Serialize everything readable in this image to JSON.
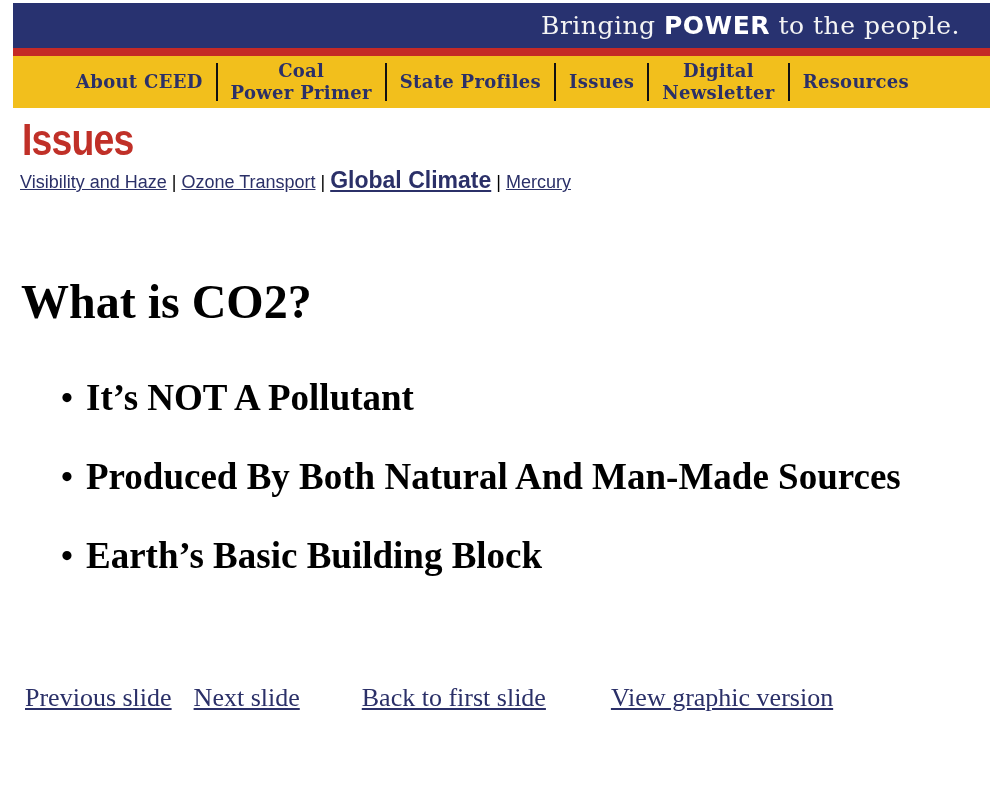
{
  "banner": {
    "tagline": "Bringing **POWER** to the people."
  },
  "nav": [
    {
      "label": "About CEED"
    },
    {
      "label": "Coal\nPower Primer"
    },
    {
      "label": "State Profiles"
    },
    {
      "label": "Issues"
    },
    {
      "label": "Digital\nNewsletter"
    },
    {
      "label": "Resources"
    }
  ],
  "section_title": "Issues",
  "subnav": {
    "separator": "|",
    "items": [
      {
        "label": "Visibility and Haze",
        "selected": false
      },
      {
        "label": "Ozone Transport",
        "selected": false
      },
      {
        "label": "Global Climate",
        "selected": true
      },
      {
        "label": "Mercury",
        "selected": false
      }
    ]
  },
  "slide": {
    "title": "What is CO2?",
    "marker": "•",
    "bullets": [
      "It’s NOT A Pollutant",
      "Produced By Both Natural And Man-Made Sources",
      "Earth’s Basic Building Block"
    ]
  },
  "footer_links": [
    "Previous slide",
    "Next slide",
    "Back to first slide",
    "View graphic version"
  ]
}
